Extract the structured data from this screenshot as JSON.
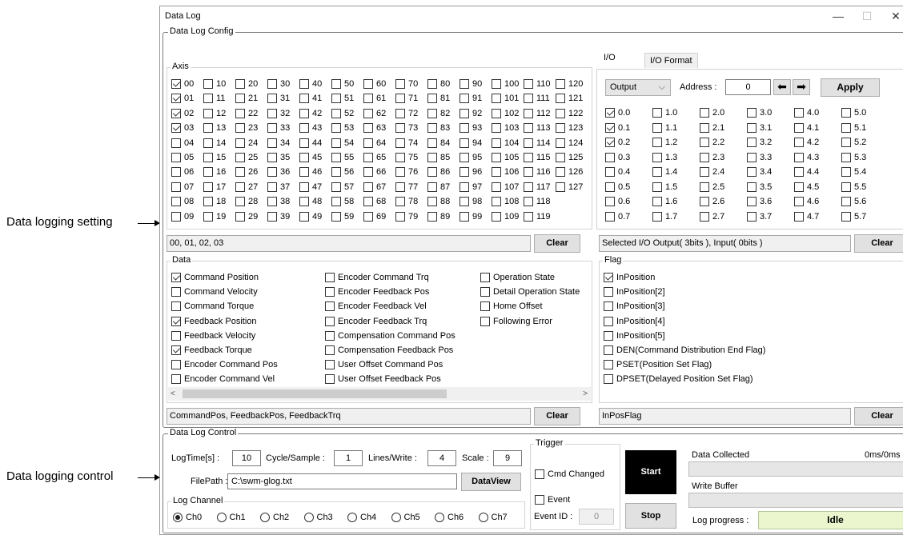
{
  "annotations": {
    "setting": "Data logging setting",
    "control": "Data logging control"
  },
  "window": {
    "title": "Data Log",
    "min": "—",
    "max": "☐",
    "close": "✕"
  },
  "config": {
    "title": "Data Log Config",
    "axis_title": "Axis",
    "axis_columns": [
      [
        "00",
        "01",
        "02",
        "03",
        "04",
        "05",
        "06",
        "07",
        "08",
        "09"
      ],
      [
        "10",
        "11",
        "12",
        "13",
        "14",
        "15",
        "16",
        "17",
        "18",
        "19"
      ],
      [
        "20",
        "21",
        "22",
        "23",
        "24",
        "25",
        "26",
        "27",
        "28",
        "29"
      ],
      [
        "30",
        "31",
        "32",
        "33",
        "34",
        "35",
        "36",
        "37",
        "38",
        "39"
      ],
      [
        "40",
        "41",
        "42",
        "43",
        "44",
        "45",
        "46",
        "47",
        "48",
        "49"
      ],
      [
        "50",
        "51",
        "52",
        "53",
        "54",
        "55",
        "56",
        "57",
        "58",
        "59"
      ],
      [
        "60",
        "61",
        "62",
        "63",
        "64",
        "65",
        "66",
        "67",
        "68",
        "69"
      ],
      [
        "70",
        "71",
        "72",
        "73",
        "74",
        "75",
        "76",
        "77",
        "78",
        "79"
      ],
      [
        "80",
        "81",
        "82",
        "83",
        "84",
        "85",
        "86",
        "87",
        "88",
        "89"
      ],
      [
        "90",
        "91",
        "92",
        "93",
        "94",
        "95",
        "96",
        "97",
        "98",
        "99"
      ],
      [
        "100",
        "101",
        "102",
        "103",
        "104",
        "105",
        "106",
        "107",
        "108",
        "109"
      ],
      [
        "110",
        "111",
        "112",
        "113",
        "114",
        "115",
        "116",
        "117",
        "118",
        "119"
      ],
      [
        "120",
        "121",
        "122",
        "123",
        "124",
        "125",
        "126",
        "127"
      ]
    ],
    "axis_checked": [
      "00",
      "01",
      "02",
      "03"
    ],
    "axis_summary": "00, 01, 02, 03",
    "clear": "Clear",
    "tabs": [
      "I/O",
      "I/O Format"
    ],
    "io_mode": "Output",
    "address_label": "Address :",
    "address_value": "0",
    "apply": "Apply",
    "io_columns": [
      [
        "0.0",
        "0.1",
        "0.2",
        "0.3",
        "0.4",
        "0.5",
        "0.6",
        "0.7"
      ],
      [
        "1.0",
        "1.1",
        "1.2",
        "1.3",
        "1.4",
        "1.5",
        "1.6",
        "1.7"
      ],
      [
        "2.0",
        "2.1",
        "2.2",
        "2.3",
        "2.4",
        "2.5",
        "2.6",
        "2.7"
      ],
      [
        "3.0",
        "3.1",
        "3.2",
        "3.3",
        "3.4",
        "3.5",
        "3.6",
        "3.7"
      ],
      [
        "4.0",
        "4.1",
        "4.2",
        "4.3",
        "4.4",
        "4.5",
        "4.6",
        "4.7"
      ],
      [
        "5.0",
        "5.1",
        "5.2",
        "5.3",
        "5.4",
        "5.5",
        "5.6",
        "5.7"
      ]
    ],
    "io_checked": [
      "0.0",
      "0.1",
      "0.2"
    ],
    "io_summary": "Selected I/O Output( 3bits ), Input( 0bits )",
    "data_title": "Data",
    "data_columns": [
      [
        {
          "label": "Command Position",
          "checked": true
        },
        {
          "label": "Command Velocity",
          "checked": false
        },
        {
          "label": "Command Torque",
          "checked": false
        },
        {
          "label": "Feedback Position",
          "checked": true
        },
        {
          "label": "Feedback Velocity",
          "checked": false
        },
        {
          "label": "Feedback Torque",
          "checked": true
        },
        {
          "label": "Encoder Command Pos",
          "checked": false
        },
        {
          "label": "Encoder Command Vel",
          "checked": false
        }
      ],
      [
        {
          "label": "Encoder Command Trq",
          "checked": false
        },
        {
          "label": "Encoder Feedback Pos",
          "checked": false
        },
        {
          "label": "Encoder Feedback Vel",
          "checked": false
        },
        {
          "label": "Encoder Feedback Trq",
          "checked": false
        },
        {
          "label": "Compensation Command Pos",
          "checked": false
        },
        {
          "label": "Compensation Feedback Pos",
          "checked": false
        },
        {
          "label": "User Offset Command Pos",
          "checked": false
        },
        {
          "label": "User Offset Feedback Pos",
          "checked": false
        }
      ],
      [
        {
          "label": "Operation State",
          "checked": false
        },
        {
          "label": "Detail Operation State",
          "checked": false
        },
        {
          "label": "Home Offset",
          "checked": false
        },
        {
          "label": "Following Error",
          "checked": false
        }
      ]
    ],
    "data_summary": "CommandPos, FeedbackPos, FeedbackTrq",
    "flag_title": "Flag",
    "flags": [
      {
        "label": "InPosition",
        "checked": true
      },
      {
        "label": "InPosition[2]",
        "checked": false
      },
      {
        "label": "InPosition[3]",
        "checked": false
      },
      {
        "label": "InPosition[4]",
        "checked": false
      },
      {
        "label": "InPosition[5]",
        "checked": false
      },
      {
        "label": "DEN(Command Distribution End Flag)",
        "checked": false
      },
      {
        "label": "PSET(Position Set Flag)",
        "checked": false
      },
      {
        "label": "DPSET(Delayed Position Set Flag)",
        "checked": false
      }
    ],
    "flag_summary": "InPosFlag"
  },
  "control": {
    "title": "Data Log Control",
    "logtime_label": "LogTime[s] :",
    "logtime": "10",
    "cycle_label": "Cycle/Sample :",
    "cycle": "1",
    "lines_label": "Lines/Write :",
    "lines": "4",
    "scale_label": "Scale :",
    "scale": "9",
    "filepath_label": "FilePath :",
    "filepath": "C:\\swm-glog.txt",
    "dataview": "DataView",
    "channel_title": "Log Channel",
    "channels": [
      "Ch0",
      "Ch1",
      "Ch2",
      "Ch3",
      "Ch4",
      "Ch5",
      "Ch6",
      "Ch7"
    ],
    "channel_selected": "Ch0",
    "trigger_title": "Trigger",
    "cmd_changed": "Cmd Changed",
    "event": "Event",
    "event_id_label": "Event ID :",
    "event_id": "0",
    "start": "Start",
    "stop": "Stop",
    "collected_label": "Data Collected",
    "collected_value": "0ms/0ms",
    "write_buffer_label": "Write Buffer",
    "progress_label": "Log progress :",
    "progress_value": "Idle"
  }
}
